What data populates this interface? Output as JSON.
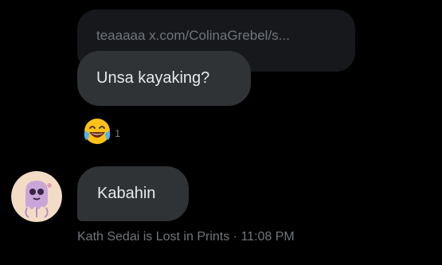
{
  "quoted_message": {
    "text": "teaaaaa x.com/ColinaGrebel/s..."
  },
  "reply_message": {
    "text": "Unsa kayaking?"
  },
  "reaction": {
    "emoji_icon": "face-with-tears-of-joy-icon",
    "count": "1"
  },
  "message": {
    "text": "Kabahin",
    "sender_name": "Kath Sedai is Lost in Prints",
    "separator": "·",
    "time": "11:08 PM"
  },
  "colors": {
    "background": "#000000",
    "bubble": "#2f3336",
    "quoted_bubble": "#16181c",
    "primary_text": "#e7e9ea",
    "secondary_text": "#71767b"
  }
}
